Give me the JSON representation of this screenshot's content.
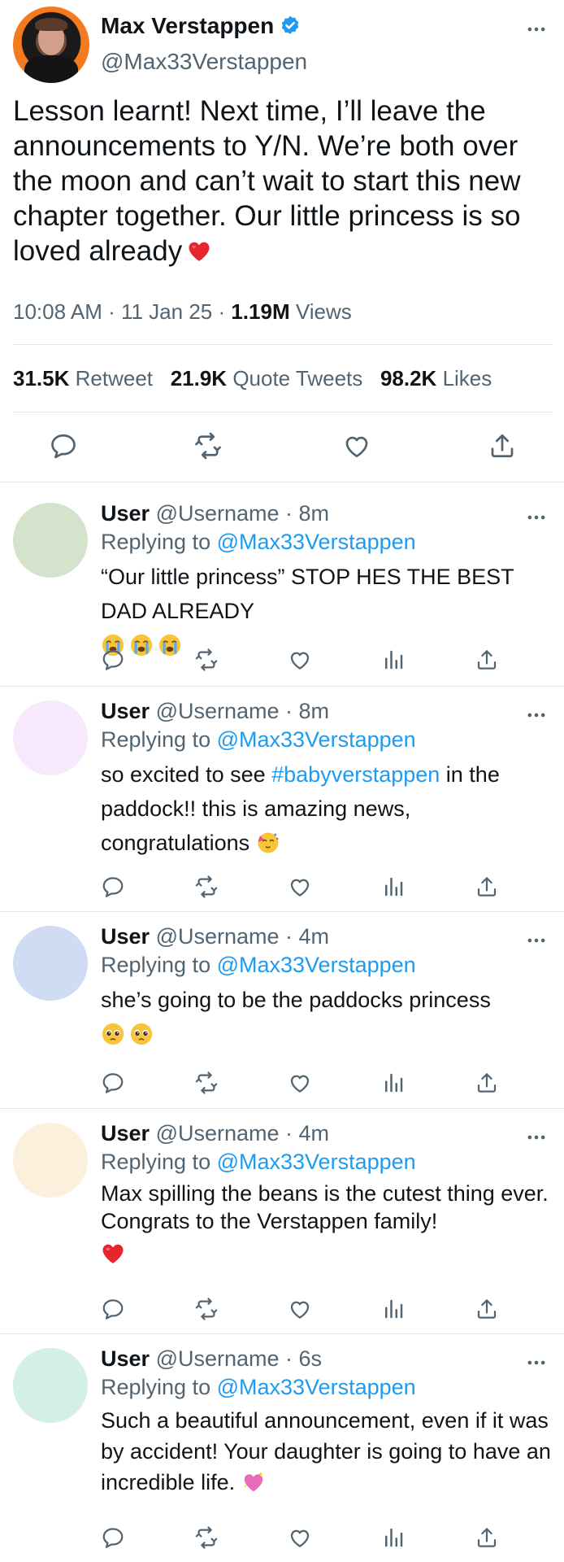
{
  "main_tweet": {
    "author_name": "Max Verstappen",
    "handle": "@Max33Verstappen",
    "text": "Lesson learnt! Next time, I’ll leave the announcements to Y/N. We’re both over the moon and can’t wait to start this new chapter together. Our little princess is so loved already",
    "time": "10:08 AM · 11 Jan 25 · ",
    "views_count": "1.19M",
    "views_label": " Views",
    "stats": {
      "retweets_count": "31.5K",
      "retweets_label": "Retweet",
      "quotes_count": "21.9K",
      "quotes_label": "Quote Tweets",
      "likes_count": "98.2K",
      "likes_label": "Likes"
    },
    "icons": [
      "reply-icon",
      "retweet-icon",
      "like-icon",
      "share-icon"
    ]
  },
  "replies": [
    {
      "user": "User",
      "handle_time": "@Username · 8m",
      "replying_prefix": "Replying to ",
      "replying_handle": "@Max33Verstappen",
      "text": "“Our little princess” STOP HES THE BEST DAD ALREADY",
      "avatar_color": "#d4e3cc"
    },
    {
      "user": "User",
      "handle_time": "@Username · 8m",
      "replying_prefix": "Replying to ",
      "replying_handle": "@Max33Verstappen",
      "text_before": "so excited to see ",
      "hashtag": "#babyverstappen",
      "text_after": " in the paddock!! this is amazing news, congratulations",
      "avatar_color": "#f8e8fb"
    },
    {
      "user": "User",
      "handle_time": "@Username · 4m",
      "replying_prefix": "Replying to ",
      "replying_handle": "@Max33Verstappen",
      "text": "she’s going to be the paddocks princess",
      "avatar_color": "#cfdcf2"
    },
    {
      "user": "User",
      "handle_time": "@Username · 4m",
      "replying_prefix": "Replying to ",
      "replying_handle": "@Max33Verstappen",
      "text": "Max spilling the beans is the cutest thing ever. Congrats to the Verstappen family!",
      "avatar_color": "#fbf0dc"
    },
    {
      "user": "User",
      "handle_time": "@Username · 6s",
      "replying_prefix": "Replying to ",
      "replying_handle": "@Max33Verstappen",
      "text": "Such a beautiful announcement, even if it was by accident! Your daughter is going to have an incredible life.",
      "avatar_color": "#d3efe6"
    }
  ],
  "colors": {
    "accent": "#1d9bf0",
    "secondary_text": "#536471",
    "divider": "#e1e6ea",
    "heart_red": "#e8242e"
  }
}
